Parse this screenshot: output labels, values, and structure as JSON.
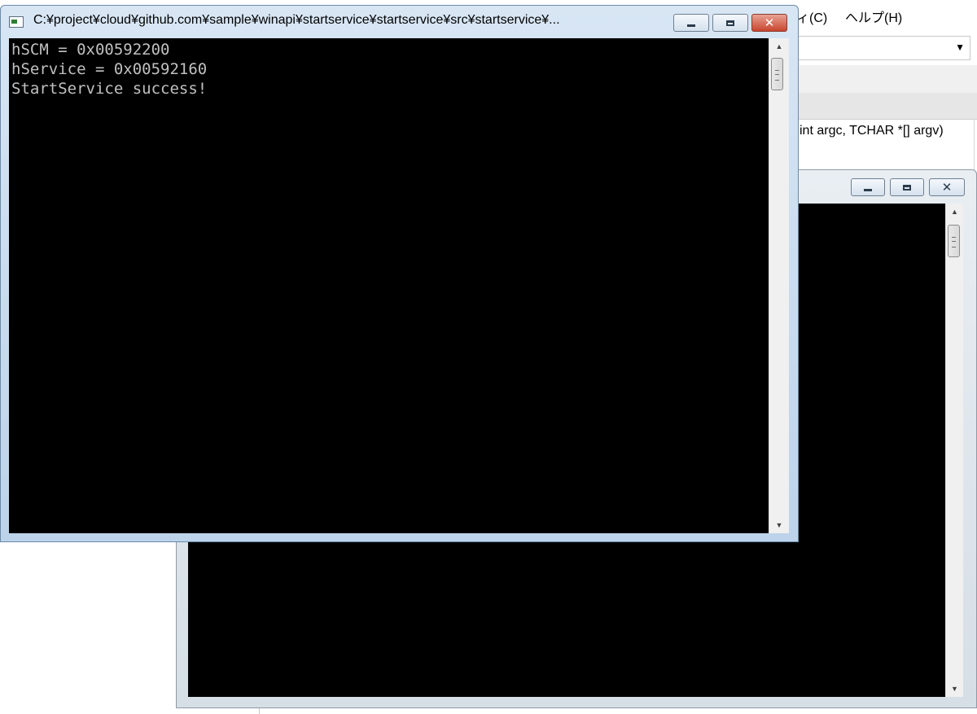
{
  "ide": {
    "menu": [
      {
        "label": "ィ(C)"
      },
      {
        "label": "ヘルプ(H)"
      }
    ],
    "combo_arrow": "▼",
    "code_line": "int argc, TCHAR *[] argv)"
  },
  "console_front": {
    "title": "C:¥project¥cloud¥github.com¥sample¥winapi¥startservice¥startservice¥src¥startservice¥...",
    "output": [
      "hSCM = 0x00592200",
      "hService = 0x00592160",
      "StartService success!"
    ],
    "state": "active"
  },
  "console_back": {
    "title": "",
    "output": [],
    "state": "inactive"
  },
  "scrollbar": {
    "up_arrow": "▲",
    "down_arrow": "▼"
  },
  "caption_buttons": {
    "close_glyph": "✕"
  }
}
